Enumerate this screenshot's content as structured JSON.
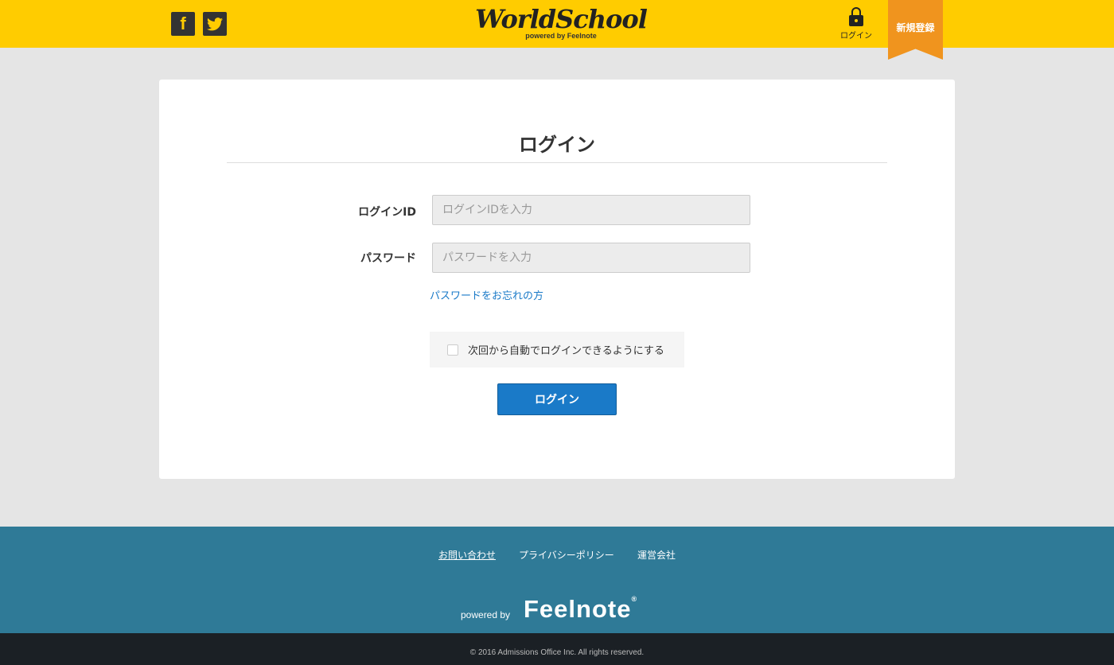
{
  "header": {
    "social": [
      {
        "label": "f",
        "icon": "facebook-icon"
      },
      {
        "label": "t",
        "icon": "twitter-icon"
      }
    ],
    "logo": {
      "main": "WorldSchool",
      "sub": "powered by Feelnote"
    },
    "login_label": "ログイン",
    "register_label": "新規登録"
  },
  "login": {
    "title": "ログイン",
    "id_label": "ログインID",
    "id_placeholder": "ログインIDを入力",
    "id_value": "",
    "password_label": "パスワード",
    "password_placeholder": "パスワードを入力",
    "password_value": "",
    "forgot_link": "パスワードをお忘れの方",
    "remember_label": "次回から自動でログインできるようにする",
    "remember_checked": false,
    "submit_label": "ログイン"
  },
  "footer": {
    "links": [
      "お問い合わせ",
      "プライバシーポリシー",
      "運営会社"
    ],
    "powered_by": "powered by",
    "brand": "Feelnote",
    "brand_mark": "®",
    "copyright": "© 2016 Admissions Office Inc. All rights reserved."
  },
  "colors": {
    "header_bg": "#ffcc00",
    "register_ribbon": "#f0941e",
    "primary_button": "#1a7ac8",
    "footer_bg": "#2f7a97",
    "bottom_bar": "#1b2025"
  }
}
